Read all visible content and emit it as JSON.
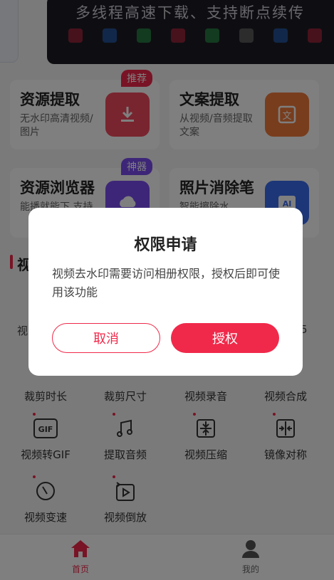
{
  "banner": {
    "text": "多线程高速下载、支持断点续传"
  },
  "cards": [
    {
      "title": "资源提取",
      "desc": "无水印高清视频/图片",
      "badge": "推荐",
      "badge_color": "#f0294a",
      "icon": "download-icon",
      "icon_color": "#f04a5e"
    },
    {
      "title": "文案提取",
      "desc": "从视频/音频提取文案",
      "badge": "",
      "icon": "document-text-icon",
      "icon_color": "#f07a3a"
    },
    {
      "title": "资源浏览器",
      "desc": "能播就能下,支持",
      "badge": "神器",
      "badge_color": "#7a4df0",
      "icon": "cloud-link-icon",
      "icon_color": "#7a4df0"
    },
    {
      "title": "照片消除笔",
      "desc": "智能擦除水",
      "badge": "",
      "icon": "ai-eraser-icon",
      "icon_color": "#3a6cf0"
    }
  ],
  "section": {
    "title": "视",
    "peek_left": "视",
    "peek_right": "5"
  },
  "tools": [
    {
      "label": "裁剪时长",
      "icon": "crop-time-icon"
    },
    {
      "label": "裁剪尺寸",
      "icon": "crop-size-icon"
    },
    {
      "label": "视频录音",
      "icon": "record-icon"
    },
    {
      "label": "视频合成",
      "icon": "merge-icon"
    },
    {
      "label": "视频转GIF",
      "icon": "gif-icon"
    },
    {
      "label": "提取音频",
      "icon": "music-note-icon"
    },
    {
      "label": "视频压缩",
      "icon": "compress-icon"
    },
    {
      "label": "镜像对称",
      "icon": "mirror-icon"
    },
    {
      "label": "视频变速",
      "icon": "speed-gauge-icon"
    },
    {
      "label": "视频倒放",
      "icon": "reverse-play-icon"
    }
  ],
  "nav": {
    "home": {
      "label": "首页",
      "active_color": "#f0294a"
    },
    "mine": {
      "label": "我的",
      "color": "#666666"
    }
  },
  "dialog": {
    "title": "权限申请",
    "message": "视频去水印需要访问相册权限，授权后即可使用该功能",
    "cancel": "取消",
    "confirm": "授权"
  }
}
